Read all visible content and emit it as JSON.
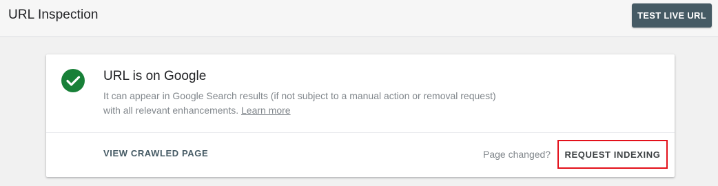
{
  "header": {
    "title": "URL Inspection",
    "test_live_url_label": "TEST LIVE URL"
  },
  "status_card": {
    "icon": "check-circle-icon",
    "title": "URL is on Google",
    "description": "It can appear in Google Search results (if not subject to a manual action or removal request) with all relevant enhancements.",
    "learn_more_label": "Learn more",
    "view_crawled_page_label": "VIEW CRAWLED PAGE",
    "page_changed_label": "Page changed?",
    "request_indexing_label": "REQUEST INDEXING"
  },
  "colors": {
    "success_green": "#188038",
    "button_dark": "#455a64",
    "highlight_red": "#e3101a",
    "muted_text": "#80868b"
  }
}
